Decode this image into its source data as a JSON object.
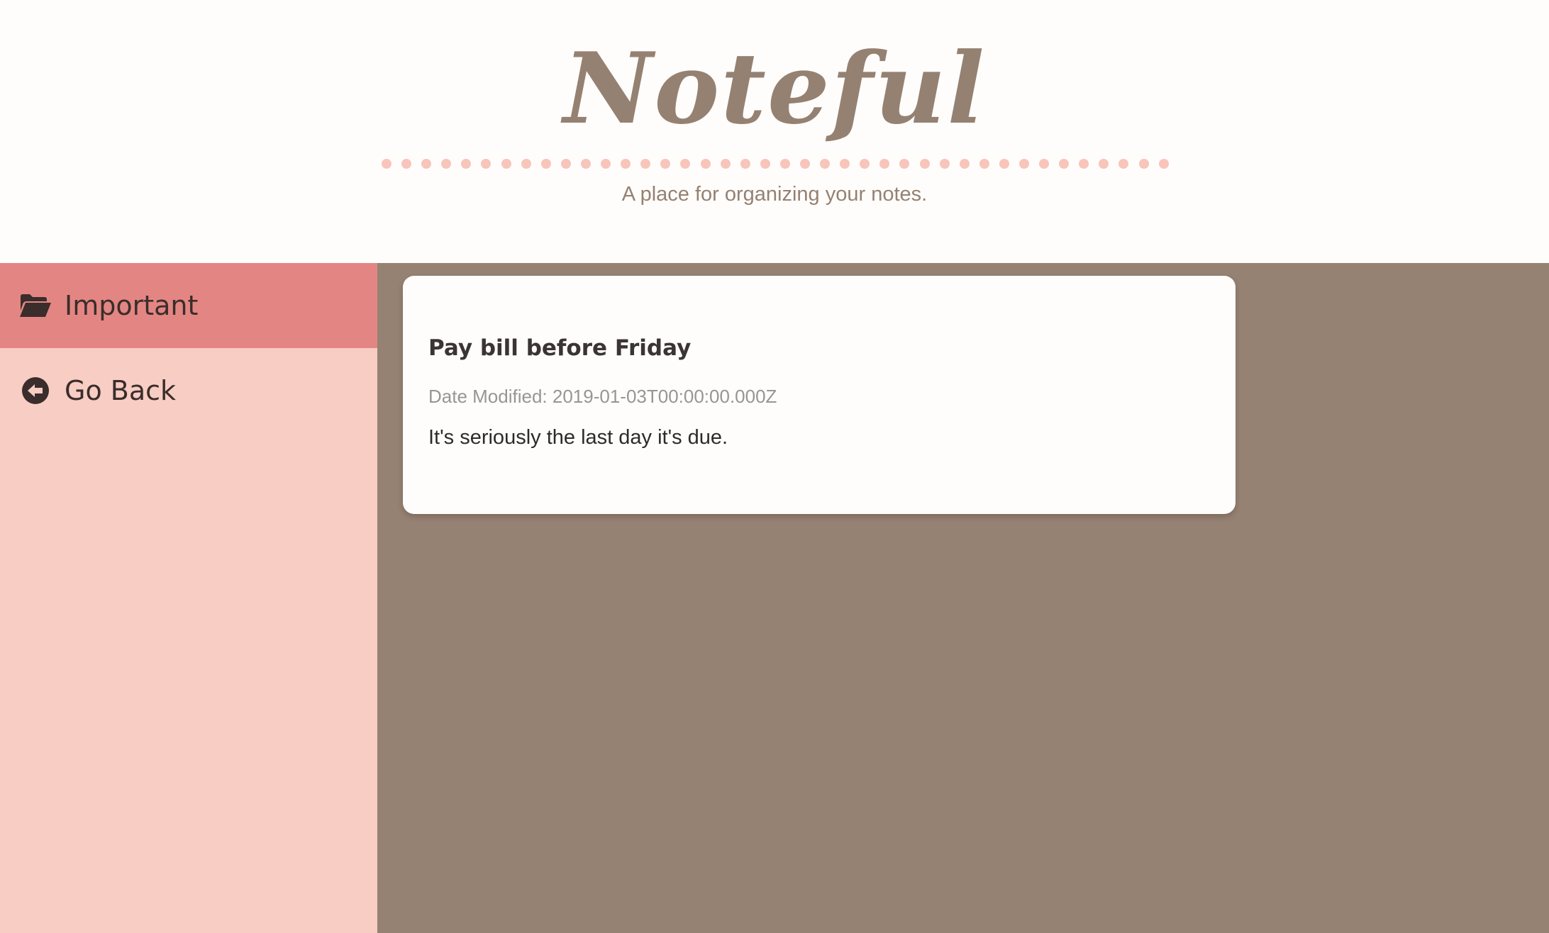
{
  "header": {
    "title": "Noteful",
    "tagline": "A place for organizing your notes."
  },
  "sidebar": {
    "active_folder": {
      "label": "Important",
      "icon": "folder-open-icon"
    },
    "back": {
      "label": "Go Back",
      "icon": "arrow-circle-left-icon"
    }
  },
  "note": {
    "title": "Pay bill before Friday",
    "date_modified": "Date Modified: 2019-01-03T00:00:00.000Z",
    "content": "It's seriously the last day it's due."
  },
  "colors": {
    "header_bg": "#fffdfb",
    "brand_text": "#958172",
    "dot_accent": "#f8c5bb",
    "sidebar_bg": "#f8cdc3",
    "sidebar_active_bg": "#e38683",
    "main_bg": "#958273",
    "card_bg": "#fffdfb"
  }
}
